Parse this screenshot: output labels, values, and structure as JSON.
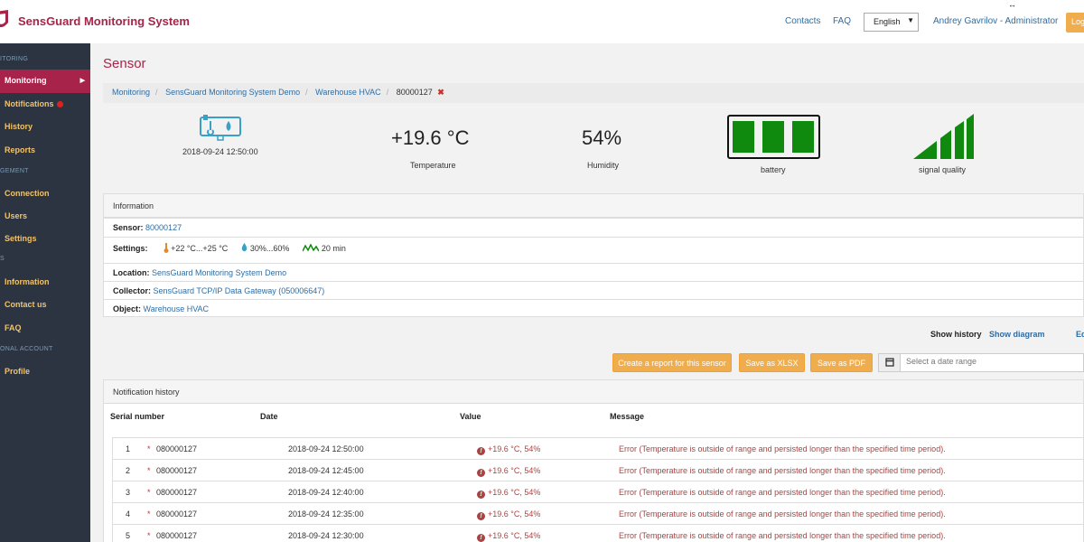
{
  "app": {
    "title": "SensGuard Monitoring System"
  },
  "header": {
    "contacts": "Contacts",
    "faq": "FAQ",
    "language": "English",
    "user": "Andrey Gavrilov - Administrator",
    "logout": "Log"
  },
  "sidebar": {
    "sections": [
      "ITORING",
      "GEMENT",
      "S",
      "ONAL ACCOUNT"
    ],
    "items": [
      {
        "label": "Monitoring"
      },
      {
        "label": "Notifications"
      },
      {
        "label": "History"
      },
      {
        "label": "Reports"
      },
      {
        "label": "Connection"
      },
      {
        "label": "Users"
      },
      {
        "label": "Settings"
      },
      {
        "label": "Information"
      },
      {
        "label": "Contact us"
      },
      {
        "label": "FAQ"
      },
      {
        "label": "Profile"
      }
    ]
  },
  "page": {
    "title": "Sensor"
  },
  "breadcrumb": {
    "items": [
      "Monitoring",
      "SensGuard Monitoring System Demo",
      "Warehouse HVAC"
    ],
    "current": "80000127",
    "remove": "✖"
  },
  "status": {
    "timestamp": "2018-09-24 12:50:00",
    "temperature": "+19.6 °C",
    "temperature_label": "Temperature",
    "humidity": "54%",
    "humidity_label": "Humidity",
    "battery_label": "battery",
    "battery_level": 1.0,
    "signal_label": "signal quality",
    "signal_level": 1.0
  },
  "information": {
    "title": "Information",
    "sensor_label": "Sensor:",
    "sensor_value": "80000127",
    "settings_label": "Settings:",
    "temp_range": "+22 °C...+25 °C",
    "humidity_range": "30%...60%",
    "interval": "20 min",
    "location_label": "Location:",
    "location_value": "SensGuard Monitoring System Demo",
    "collector_label": "Collector:",
    "collector_value": "SensGuard TCP/IP Data Gateway (050006647)",
    "object_label": "Object:",
    "object_value": "Warehouse HVAC"
  },
  "view": {
    "show_history": "Show history",
    "show_diagram": "Show diagram",
    "edit": "Ed"
  },
  "actions": {
    "report": "Create a report for this sensor",
    "xlsx": "Save as XLSX",
    "pdf": "Save as PDF",
    "date_placeholder": "Select a date range"
  },
  "notification_history": {
    "title": "Notification history",
    "columns": [
      "Serial number",
      "Date",
      "Value",
      "Message"
    ],
    "rows": [
      {
        "num": "1",
        "serial": "080000127",
        "date": "2018-09-24 12:50:00",
        "value": "+19.6 °C, 54%",
        "message": "Error (Temperature is outside of range and persisted longer than the specified time period)."
      },
      {
        "num": "2",
        "serial": "080000127",
        "date": "2018-09-24 12:45:00",
        "value": "+19.6 °C, 54%",
        "message": "Error (Temperature is outside of range and persisted longer than the specified time period)."
      },
      {
        "num": "3",
        "serial": "080000127",
        "date": "2018-09-24 12:40:00",
        "value": "+19.6 °C, 54%",
        "message": "Error (Temperature is outside of range and persisted longer than the specified time period)."
      },
      {
        "num": "4",
        "serial": "080000127",
        "date": "2018-09-24 12:35:00",
        "value": "+19.6 °C, 54%",
        "message": "Error (Temperature is outside of range and persisted longer than the specified time period)."
      },
      {
        "num": "5",
        "serial": "080000127",
        "date": "2018-09-24 12:30:00",
        "value": "+19.6 °C, 54%",
        "message": "Error (Temperature is outside of range and persisted longer than the specified time period)."
      }
    ]
  },
  "colors": {
    "brand": "#a8234a",
    "link": "#2f6da3",
    "sidebar_bg": "#2c3442",
    "sidebar_text": "#f0c36d",
    "ok": "#0f8a0f",
    "error": "#a94442",
    "button": "#f0ad4e"
  }
}
